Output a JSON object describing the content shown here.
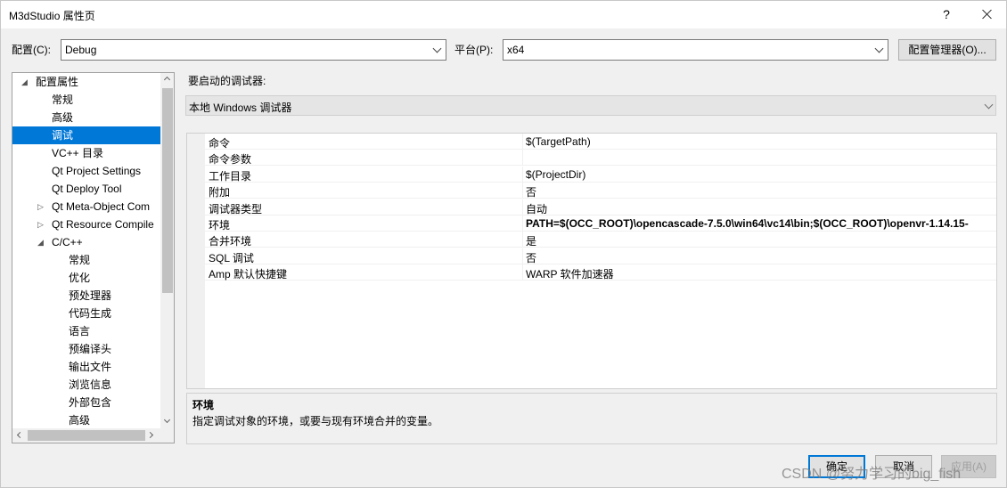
{
  "window": {
    "title": "M3dStudio 属性页",
    "help_label": "?"
  },
  "config": {
    "config_label": "配置(C):",
    "config_value": "Debug",
    "platform_label": "平台(P):",
    "platform_value": "x64",
    "manager_button": "配置管理器(O)..."
  },
  "tree": {
    "items": [
      {
        "label": "配置属性",
        "expander": "◢"
      },
      {
        "label": "常规"
      },
      {
        "label": "高级"
      },
      {
        "label": "调试"
      },
      {
        "label": "VC++ 目录"
      },
      {
        "label": "Qt Project Settings"
      },
      {
        "label": "Qt Deploy Tool"
      },
      {
        "label": "Qt Meta-Object Com",
        "expander": "▷"
      },
      {
        "label": "Qt Resource Compile",
        "expander": "▷"
      },
      {
        "label": "C/C++",
        "expander": "◢"
      },
      {
        "label": "常规"
      },
      {
        "label": "优化"
      },
      {
        "label": "预处理器"
      },
      {
        "label": "代码生成"
      },
      {
        "label": "语言"
      },
      {
        "label": "预编译头"
      },
      {
        "label": "输出文件"
      },
      {
        "label": "浏览信息"
      },
      {
        "label": "外部包含"
      },
      {
        "label": "高级"
      }
    ],
    "selected_index": 3
  },
  "debugger": {
    "label": "要启动的调试器:",
    "value": "本地 Windows 调试器"
  },
  "properties": [
    {
      "name": "命令",
      "value": "$(TargetPath)"
    },
    {
      "name": "命令参数",
      "value": ""
    },
    {
      "name": "工作目录",
      "value": "$(ProjectDir)"
    },
    {
      "name": "附加",
      "value": "否"
    },
    {
      "name": "调试器类型",
      "value": "自动"
    },
    {
      "name": "环境",
      "value": "PATH=$(OCC_ROOT)\\opencascade-7.5.0\\win64\\vc14\\bin;$(OCC_ROOT)\\openvr-1.14.15-"
    },
    {
      "name": "合并环境",
      "value": "是"
    },
    {
      "name": "SQL 调试",
      "value": "否"
    },
    {
      "name": "Amp 默认快捷键",
      "value": "WARP 软件加速器"
    }
  ],
  "description": {
    "title": "环境",
    "text": "指定调试对象的环境，或要与现有环境合并的变量。"
  },
  "buttons": {
    "ok": "确定",
    "cancel": "取消",
    "apply": "应用(A)"
  },
  "watermark": "CSDN @努力学习的big_fish"
}
